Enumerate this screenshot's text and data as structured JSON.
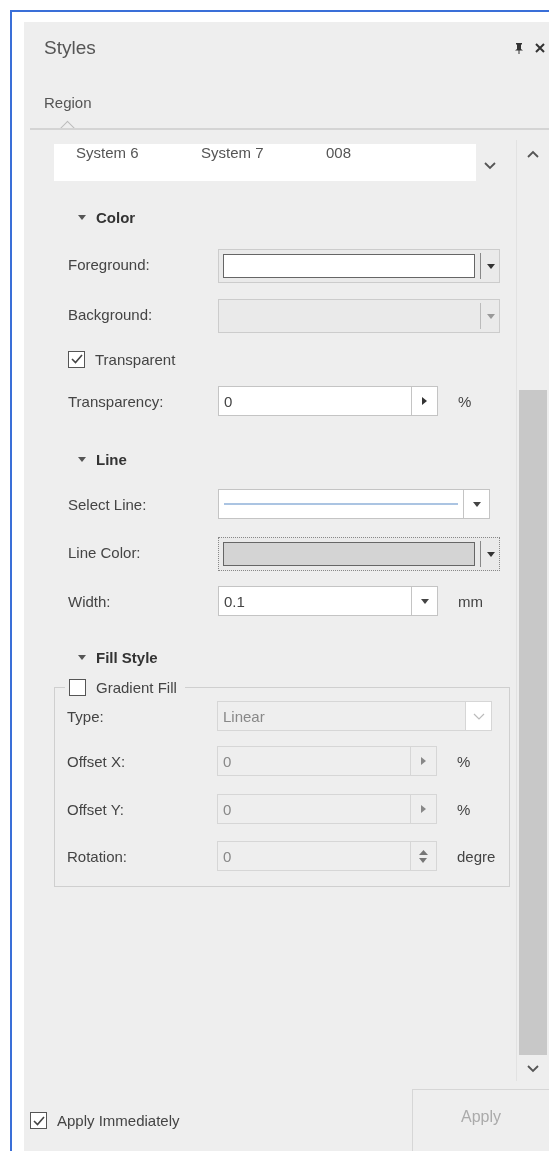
{
  "panel": {
    "title": "Styles"
  },
  "tabs": [
    {
      "label": "Region",
      "selected": true
    }
  ],
  "style_gallery": {
    "items": [
      "System 6",
      "System 7",
      "008"
    ]
  },
  "sections": [
    {
      "title": "Color",
      "expanded": true,
      "rows": [
        {
          "kind": "color",
          "label": "Foreground:",
          "color": "#ffffff",
          "disabled": false,
          "focused": false
        },
        {
          "kind": "color",
          "label": "Background:",
          "disabled": true,
          "focused": false
        },
        {
          "kind": "checkbox",
          "label": "Transparent",
          "checked": true
        },
        {
          "kind": "spin",
          "label": "Transparency:",
          "value": "0",
          "unit": "%",
          "disabled": false
        }
      ]
    },
    {
      "title": "Line",
      "expanded": true,
      "rows": [
        {
          "kind": "line",
          "label": "Select Line:",
          "disabled": false
        },
        {
          "kind": "color",
          "label": "Line Color:",
          "color": "#d4d4d4",
          "disabled": false,
          "focused": true
        },
        {
          "kind": "combo",
          "label": "Width:",
          "value": "0.1",
          "unit": "mm",
          "disabled": false
        }
      ]
    },
    {
      "title": "Fill Style",
      "expanded": true,
      "group": {
        "label": "Gradient Fill",
        "checked": false,
        "rows": [
          {
            "kind": "combo",
            "label": "Type:",
            "value": "Linear",
            "disabled": true
          },
          {
            "kind": "spin",
            "label": "Offset X:",
            "value": "0",
            "unit": "%",
            "disabled": true
          },
          {
            "kind": "spin",
            "label": "Offset Y:",
            "value": "0",
            "unit": "%",
            "disabled": true
          },
          {
            "kind": "updown",
            "label": "Rotation:",
            "value": "0",
            "unit": "degre",
            "disabled": true
          }
        ]
      }
    }
  ],
  "footer": {
    "apply_immediately": {
      "label": "Apply Immediately",
      "checked": true
    },
    "apply_button": {
      "label": "Apply",
      "disabled": true
    }
  }
}
